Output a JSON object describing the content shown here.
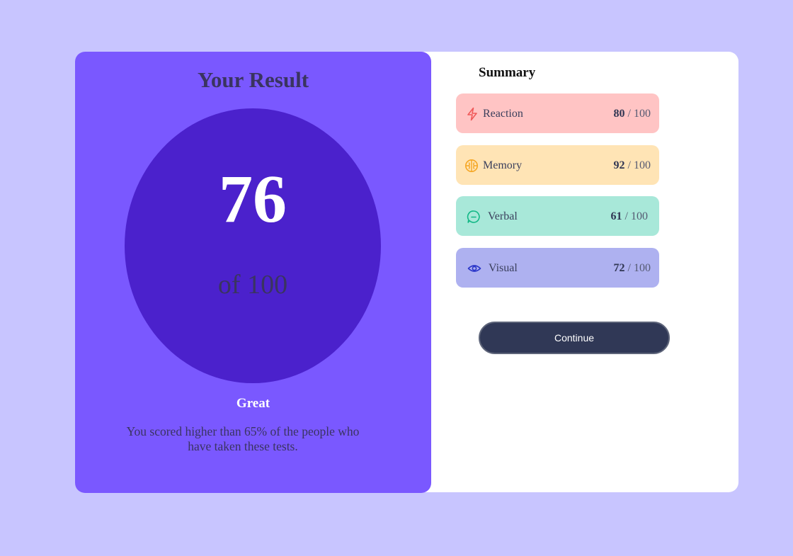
{
  "result": {
    "title": "Your Result",
    "score": "76",
    "of_label": "of 100",
    "rating": "Great",
    "description": "You scored higher than 65% of the people who have taken these tests."
  },
  "summary": {
    "title": "Summary",
    "items": [
      {
        "label": "Reaction",
        "score": "80",
        "max": " / 100",
        "icon": "lightning-icon",
        "color": "#ffc4c4",
        "icon_color": "#f05a5a"
      },
      {
        "label": "Memory",
        "score": "92",
        "max": " / 100",
        "icon": "brain-icon",
        "color": "#ffe4b5",
        "icon_color": "#f5a623"
      },
      {
        "label": "Verbal",
        "score": "61",
        "max": " / 100",
        "icon": "chat-bubble-icon",
        "color": "#a8e8d9",
        "icon_color": "#12b886"
      },
      {
        "label": "Visual",
        "score": "72",
        "max": " / 100",
        "icon": "eye-icon",
        "color": "#aeb1f0",
        "icon_color": "#2a35c9"
      }
    ]
  },
  "actions": {
    "continue_label": "Continue"
  },
  "colors": {
    "page_background": "#c8c5ff",
    "result_panel": "#7a58ff",
    "score_circle": "#4b21cc",
    "button": "#303856"
  }
}
